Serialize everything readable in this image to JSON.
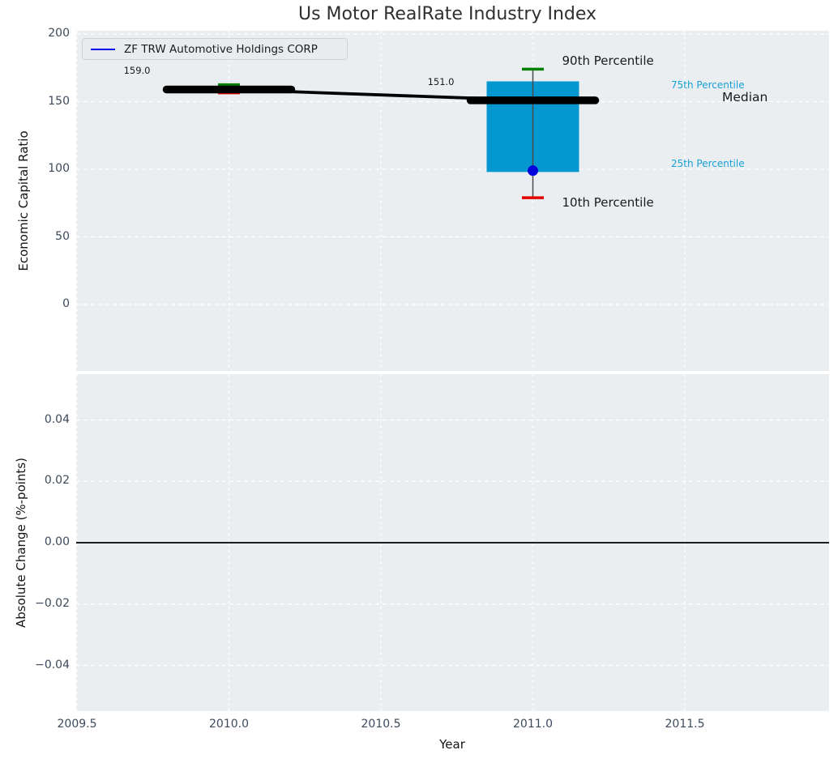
{
  "colors": {
    "axes_background": "#ebeef0",
    "grid": "#ffffff",
    "tick_label": "#3c4a5c",
    "text": "#1a1a1a",
    "box_fill": "#0598d0",
    "p90_cap": "#008000",
    "p10_cap": "#e50000",
    "outlier_dot": "#0000dc",
    "company_line": "#000000",
    "median_dash": "#000000",
    "whisker": "#4a4a4a",
    "percentile_label": "#17a1d6",
    "legend_line": "#0000f0",
    "zero_line": "#000000"
  },
  "chart_data": [
    {
      "type": "line",
      "subplot": "top",
      "title": "Us Motor RealRate Industry Index",
      "xlabel": "Year",
      "ylabel": "Economic Capital Ratio",
      "xlim": [
        2009.5,
        2011.97
      ],
      "ylim": [
        -49,
        202
      ],
      "xticks": [
        2009.5,
        2010.0,
        2010.5,
        2011.0,
        2011.5
      ],
      "yticks": [
        0,
        50,
        100,
        150,
        200
      ],
      "ytick_labels": [
        "0",
        "50",
        "100",
        "150",
        "200"
      ],
      "grid": true,
      "legend": {
        "position": "upper left",
        "entries": [
          {
            "label": "ZF TRW Automotive Holdings CORP",
            "color": "blue"
          }
        ]
      },
      "series": [
        {
          "name": "ZF TRW Automotive Holdings CORP",
          "x": [
            2010.0,
            2011.0
          ],
          "y": [
            159.0,
            151.0
          ],
          "point_labels": [
            "159.0",
            "151.0"
          ]
        }
      ],
      "boxplots": [
        {
          "x": 2010.0,
          "p10": 156.5,
          "p25": 157.5,
          "median": 159.0,
          "p75": 161.0,
          "p90": 162.5
        },
        {
          "x": 2011.0,
          "p10": 79.0,
          "p25": 98.0,
          "median": 151.0,
          "p75": 165.0,
          "p90": 174.0,
          "outlier": 99.0
        }
      ],
      "annotations": {
        "p90": "90th Percentile",
        "p75": "75th Percentile",
        "median": "Median",
        "p25": "25th Percentile",
        "p10": "10th Percentile"
      }
    },
    {
      "type": "line",
      "subplot": "bottom",
      "xlabel": "Year",
      "ylabel": "Absolute Change (%-points)",
      "xlim": [
        2009.5,
        2011.97
      ],
      "ylim": [
        -0.055,
        0.055
      ],
      "xticks": [
        2009.5,
        2010.0,
        2010.5,
        2011.0,
        2011.5
      ],
      "xtick_labels": [
        "2009.5",
        "2010.0",
        "2010.5",
        "2011.0",
        "2011.5"
      ],
      "yticks": [
        0.04,
        0.02,
        0.0,
        -0.02,
        -0.04
      ],
      "ytick_labels": [
        "0.04",
        "0.02",
        "0.00",
        "−0.02",
        "−0.04"
      ],
      "grid": true,
      "zero_line": 0.0,
      "series": []
    }
  ]
}
